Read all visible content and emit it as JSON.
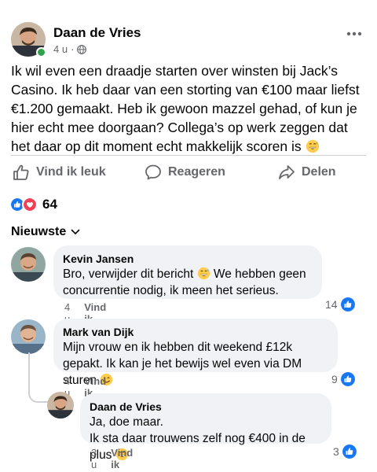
{
  "post": {
    "author": "Daan de Vries",
    "time": "4 u",
    "privacy_icon": "globe-icon",
    "text": "Ik wil even een draadje starten over winsten bij Jack’s Casino. Ik heb daar van een storting van €100 maar liefst €1.200 gemaakt. Heb ik gewoon mazzel gehad, of kun je hier echt mee doorgaan? Collega’s op werk zeggen dat het daar op dit moment echt makkelijk scoren is",
    "emoji": "grinning-sweat-emoji"
  },
  "actions": {
    "like": "Vind ik leuk",
    "comment": "Reageren",
    "share": "Delen"
  },
  "reactions": {
    "count": "64",
    "types": [
      "like-icon",
      "love-icon"
    ]
  },
  "sort": {
    "label": "Nieuwste"
  },
  "comments": [
    {
      "name": "Kevin Jansen",
      "text": "Bro, verwijder dit bericht",
      "text_after": "We hebben geen concurrentie nodig, ik meen het serieus.",
      "time": "4 u",
      "like_label": "Vind ik leuk",
      "likes": "14"
    },
    {
      "name": "Mark van Dijk",
      "text": "Mijn vrouw en ik hebben dit weekend £12k gepakt. Ik kan je het bewijs wel even via DM sturen",
      "time": "4 u",
      "like_label": "Vind ik leuk",
      "likes": "9"
    },
    {
      "name": "Daan de Vries",
      "text_line1": "Ja, doe maar.",
      "text_line2": "Ik sta daar trouwens zelf nog €400 in de plus",
      "time": "3 u",
      "like_label": "Vind ik leuk",
      "likes": "3"
    }
  ],
  "colors": {
    "accent": "#1877f2",
    "love": "#f33e58",
    "muted": "#65676b",
    "bubble": "#f0f2f5",
    "online": "#31a24c"
  }
}
